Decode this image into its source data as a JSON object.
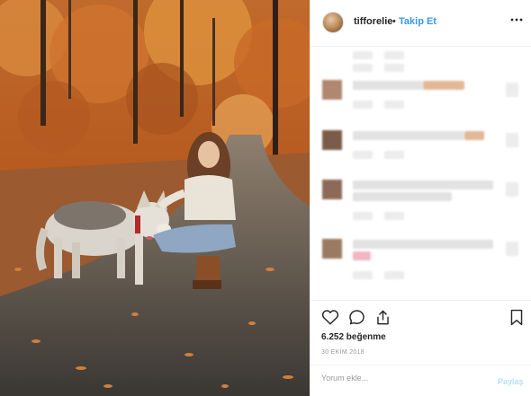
{
  "post": {
    "username": "tifforelie",
    "separator": "•",
    "follow_label": "Takip Et",
    "more_glyph": "•••",
    "likes": "6.252 beğenme",
    "date": "30 EKİM 2018",
    "photo_alt": "A woman with long wavy hair crouches on an autumn forest path petting a gray and white husky dog, orange leaves all around"
  },
  "comment": {
    "placeholder": "Yorum ekle...",
    "post_label": "Paylaş"
  },
  "icons": {
    "more": "more-options-icon",
    "like": "heart-icon",
    "comment": "comment-bubble-icon",
    "share": "share-icon",
    "save": "bookmark-icon"
  },
  "colors": {
    "accent": "#3897f0",
    "post_disabled": "#b2dffc",
    "text": "#262626",
    "muted": "#999999",
    "border": "#efefef"
  }
}
